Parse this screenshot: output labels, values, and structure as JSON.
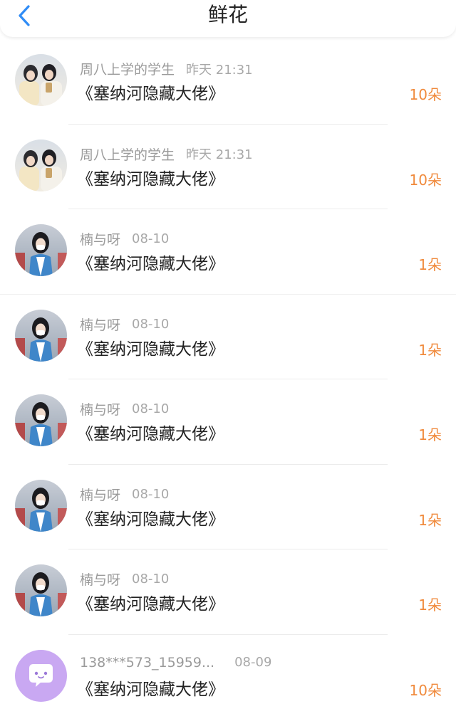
{
  "header": {
    "title": "鲜花",
    "back_icon": "chevron-left-icon",
    "accent_color": "#2f8cf6"
  },
  "list": {
    "items": [
      {
        "avatar": "photo-two-girls-avatar",
        "username": "周八上学的学生",
        "time": "昨天 21:31",
        "book": "《塞纳河隐藏大佬》",
        "count": "10朵"
      },
      {
        "avatar": "photo-two-girls-avatar",
        "username": "周八上学的学生",
        "time": "昨天 21:31",
        "book": "《塞纳河隐藏大佬》",
        "count": "10朵"
      },
      {
        "avatar": "photo-masked-girl-avatar",
        "username": "楠与呀",
        "time": "08-10",
        "book": "《塞纳河隐藏大佬》",
        "count": "1朵"
      },
      {
        "avatar": "photo-masked-girl-avatar",
        "username": "楠与呀",
        "time": "08-10",
        "book": "《塞纳河隐藏大佬》",
        "count": "1朵"
      },
      {
        "avatar": "photo-masked-girl-avatar",
        "username": "楠与呀",
        "time": "08-10",
        "book": "《塞纳河隐藏大佬》",
        "count": "1朵"
      },
      {
        "avatar": "photo-masked-girl-avatar",
        "username": "楠与呀",
        "time": "08-10",
        "book": "《塞纳河隐藏大佬》",
        "count": "1朵"
      },
      {
        "avatar": "photo-masked-girl-avatar",
        "username": "楠与呀",
        "time": "08-10",
        "book": "《塞纳河隐藏大佬》",
        "count": "1朵"
      },
      {
        "avatar": "chat-bubble-avatar",
        "username": "138***573_15959...",
        "time": "08-09",
        "book": "《塞纳河隐藏大佬》",
        "count": "10朵"
      }
    ],
    "count_color": "#f08a3c",
    "default_avatar_color": "#c9a8f2"
  }
}
